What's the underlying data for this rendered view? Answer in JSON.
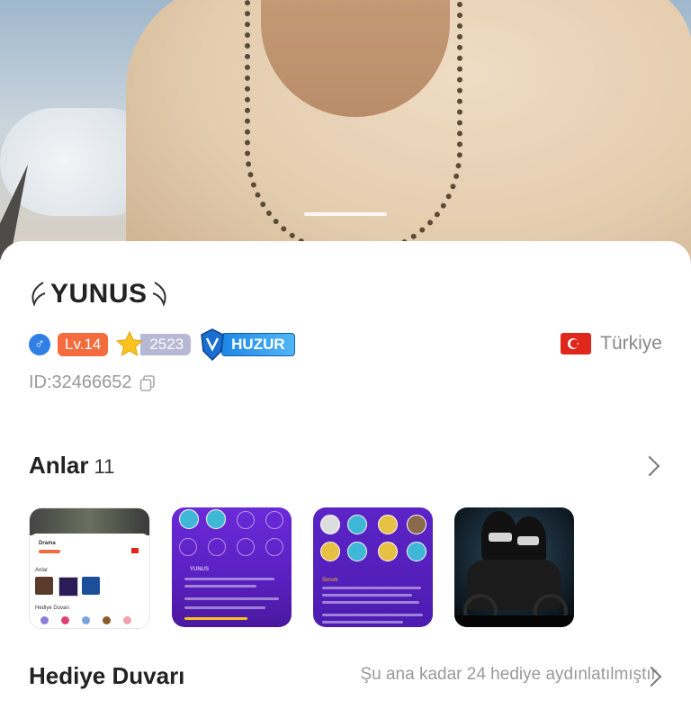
{
  "profile": {
    "name": "YUNUS",
    "level_label": "Lv.14",
    "star_value": "2523",
    "guild_name": "HUZUR",
    "country": "Türkiye",
    "id_label": "ID:32466652"
  },
  "moments": {
    "title": "Anlar",
    "count": "11",
    "thumbnails": [
      {
        "label": "Drama",
        "sub": "Anlar",
        "gift": "Hediye Duvarı"
      },
      {
        "label": "YUNUS"
      },
      {
        "label": "Sorum"
      },
      {
        "label": "photo"
      }
    ]
  },
  "gift_wall": {
    "title": "Hediye Duvarı",
    "summary": "Şu ana kadar 24 hediye aydınlatılmıştır"
  },
  "colors": {
    "level_bg": "#f46b3d",
    "gender_bg": "#2f7fe6",
    "guild_bg": "#1e88e5",
    "flag_red": "#e1261c"
  },
  "icons": {
    "gender": "male-icon",
    "star": "star-icon",
    "guild": "guild-emblem-icon",
    "copy": "copy-icon",
    "chevron": "chevron-right-icon"
  }
}
